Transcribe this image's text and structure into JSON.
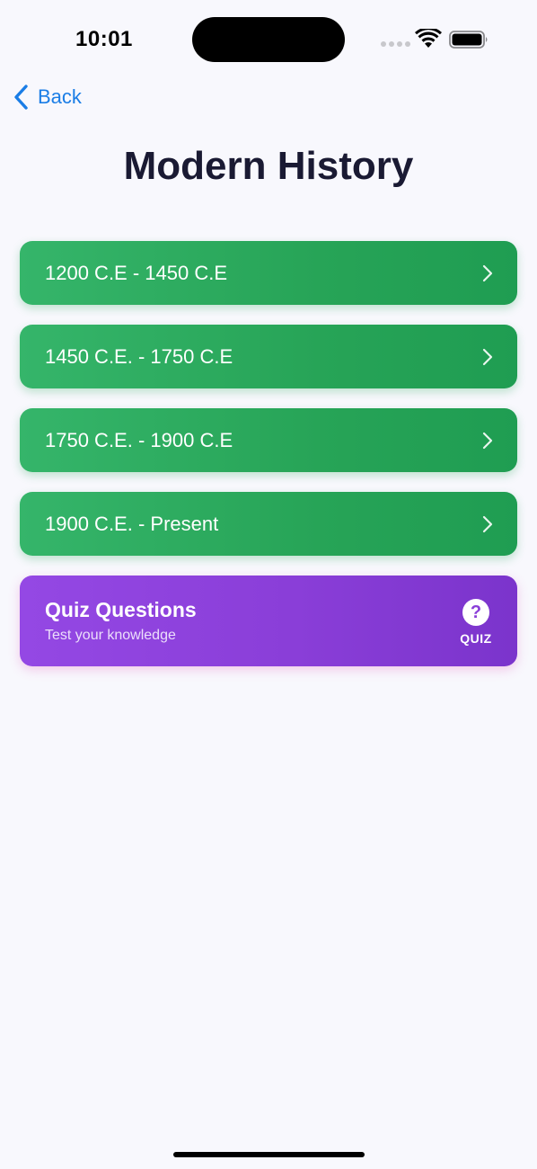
{
  "status_bar": {
    "time": "10:01",
    "icons": [
      "signal-dots-icon",
      "wifi-icon",
      "battery-icon"
    ]
  },
  "nav": {
    "back_label": "Back",
    "back_icon": "chevron-left-icon"
  },
  "page": {
    "title": "Modern History"
  },
  "periods": [
    {
      "label": "1200 C.E - 1450 C.E",
      "icon": "chevron-right-icon"
    },
    {
      "label": "1450 C.E. - 1750 C.E",
      "icon": "chevron-right-icon"
    },
    {
      "label": "1750 C.E. - 1900 C.E",
      "icon": "chevron-right-icon"
    },
    {
      "label": "1900 C.E. - Present",
      "icon": "chevron-right-icon"
    }
  ],
  "quiz": {
    "title": "Quiz Questions",
    "subtitle": "Test your knowledge",
    "icon_glyph": "?",
    "badge": "QUIZ",
    "icon": "question-icon"
  },
  "colors": {
    "background": "#f8f8fd",
    "accent_blue": "#1a7de6",
    "period_green": "#27a457",
    "quiz_purple": "#8a3ed8",
    "title_dark": "#1a1a33"
  }
}
